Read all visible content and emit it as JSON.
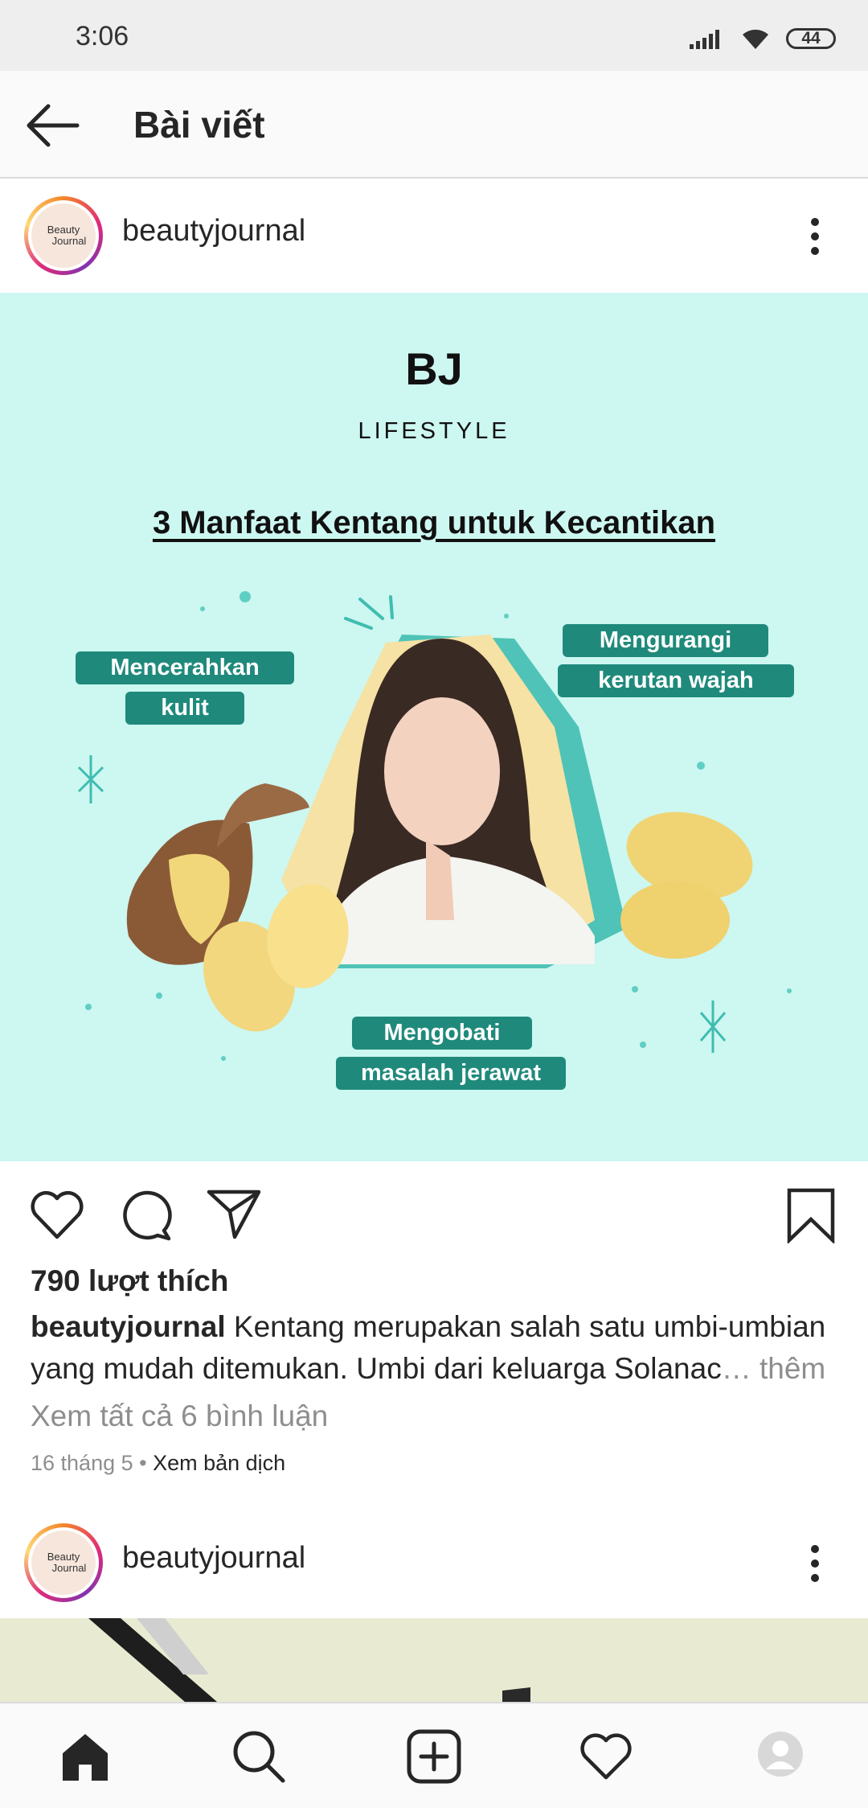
{
  "status_bar": {
    "time": "3:06",
    "battery": "44"
  },
  "header": {
    "title": "Bài viết"
  },
  "post": {
    "username": "beautyjournal",
    "avatar_text_1": "Beauty",
    "avatar_text_2": "Journal",
    "image": {
      "brand": "BJ",
      "category": "LIFESTYLE",
      "headline": "3 Manfaat Kentang untuk Kecantikan",
      "tag1_line1": "Mencerahkan",
      "tag1_line2": "kulit",
      "tag2_line1": "Mengurangi",
      "tag2_line2": "kerutan wajah",
      "tag3_line1": "Mengobati",
      "tag3_line2": "masalah jerawat",
      "background_color": "#cdf7f1",
      "tag_color": "#1f8a7b"
    },
    "likes": "790 lượt thích",
    "caption_user": "beautyjournal",
    "caption_text": "Kentang merupakan salah satu umbi-umbian yang mudah ditemukan. Umbi dari keluarga Solanac",
    "caption_more": "… thêm",
    "view_comments": "Xem tất cả 6 bình luận",
    "date": "16 tháng 5",
    "date_sep": " • ",
    "translate": "Xem bản dịch"
  },
  "post2": {
    "username": "beautyjournal",
    "avatar_text_1": "Beauty",
    "avatar_text_2": "Journal"
  },
  "icons": [
    "back-arrow-icon",
    "more-options-icon",
    "heart-icon",
    "comment-icon",
    "share-icon",
    "bookmark-icon",
    "home-icon",
    "search-icon",
    "add-post-icon",
    "activity-heart-icon",
    "profile-avatar-icon"
  ]
}
